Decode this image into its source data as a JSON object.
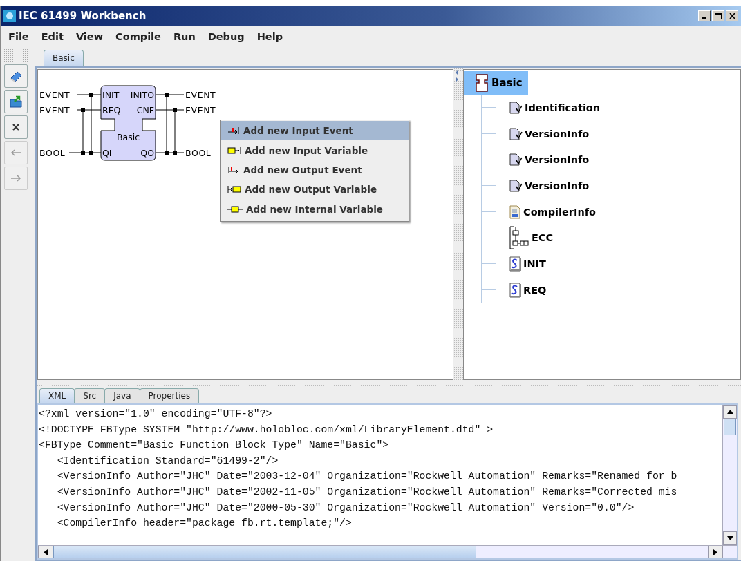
{
  "window": {
    "title": "IEC 61499 Workbench"
  },
  "menu": [
    "File",
    "Edit",
    "View",
    "Compile",
    "Run",
    "Debug",
    "Help"
  ],
  "toolbar": [
    {
      "kind": "edit",
      "disabled": false
    },
    {
      "kind": "open",
      "disabled": false
    },
    {
      "kind": "delete",
      "disabled": false
    },
    {
      "kind": "back",
      "disabled": true
    },
    {
      "kind": "forward",
      "disabled": true
    }
  ],
  "editor_tabs": [
    {
      "label": "Basic",
      "selected": true
    }
  ],
  "diagram": {
    "block_name": "Basic",
    "event_inputs": [
      {
        "port": "INIT",
        "type": "EVENT"
      },
      {
        "port": "REQ",
        "type": "EVENT"
      }
    ],
    "event_outputs": [
      {
        "port": "INITO",
        "type": "EVENT"
      },
      {
        "port": "CNF",
        "type": "EVENT"
      }
    ],
    "data_inputs": [
      {
        "port": "QI",
        "type": "BOOL"
      }
    ],
    "data_outputs": [
      {
        "port": "QO",
        "type": "BOOL"
      }
    ]
  },
  "context_menu": [
    {
      "label": "Add new Input Event",
      "kind": "input_event",
      "selected": true
    },
    {
      "label": "Add new Input Variable",
      "kind": "input_variable",
      "selected": false
    },
    {
      "label": "Add new Output Event",
      "kind": "output_event",
      "selected": false
    },
    {
      "label": "Add new Output Variable",
      "kind": "output_variable",
      "selected": false
    },
    {
      "label": "Add new Internal Variable",
      "kind": "internal_variable",
      "selected": false
    }
  ],
  "tree": {
    "label": "Basic",
    "kind": "fbtype",
    "selected": true,
    "children": [
      {
        "label": "Identification",
        "kind": "doc",
        "selected": false
      },
      {
        "label": "VersionInfo",
        "kind": "doc",
        "selected": false
      },
      {
        "label": "VersionInfo",
        "kind": "doc",
        "selected": false
      },
      {
        "label": "VersionInfo",
        "kind": "doc",
        "selected": false
      },
      {
        "label": "CompilerInfo",
        "kind": "compiler",
        "selected": false
      },
      {
        "label": "ECC",
        "kind": "ecc",
        "selected": false
      },
      {
        "label": "INIT",
        "kind": "script",
        "selected": false
      },
      {
        "label": "REQ",
        "kind": "script",
        "selected": false
      }
    ]
  },
  "bottom_tabs": [
    {
      "label": "XML",
      "selected": true
    },
    {
      "label": "Src",
      "selected": false
    },
    {
      "label": "Java",
      "selected": false
    },
    {
      "label": "Properties",
      "selected": false
    }
  ],
  "code_lines": [
    "<?xml version=\"1.0\" encoding=\"UTF-8\"?>",
    "<!DOCTYPE FBType SYSTEM \"http://www.holobloc.com/xml/LibraryElement.dtd\" >",
    "<FBType Comment=\"Basic Function Block Type\" Name=\"Basic\">",
    "   <Identification Standard=\"61499-2\"/>",
    "   <VersionInfo Author=\"JHC\" Date=\"2003-12-04\" Organization=\"Rockwell Automation\" Remarks=\"Renamed for b",
    "   <VersionInfo Author=\"JHC\" Date=\"2002-11-05\" Organization=\"Rockwell Automation\" Remarks=\"Corrected mis",
    "   <VersionInfo Author=\"JHC\" Date=\"2000-05-30\" Organization=\"Rockwell Automation\" Version=\"0.0\"/>",
    "   <CompilerInfo header=\"package fb.rt.template;\"/>"
  ]
}
